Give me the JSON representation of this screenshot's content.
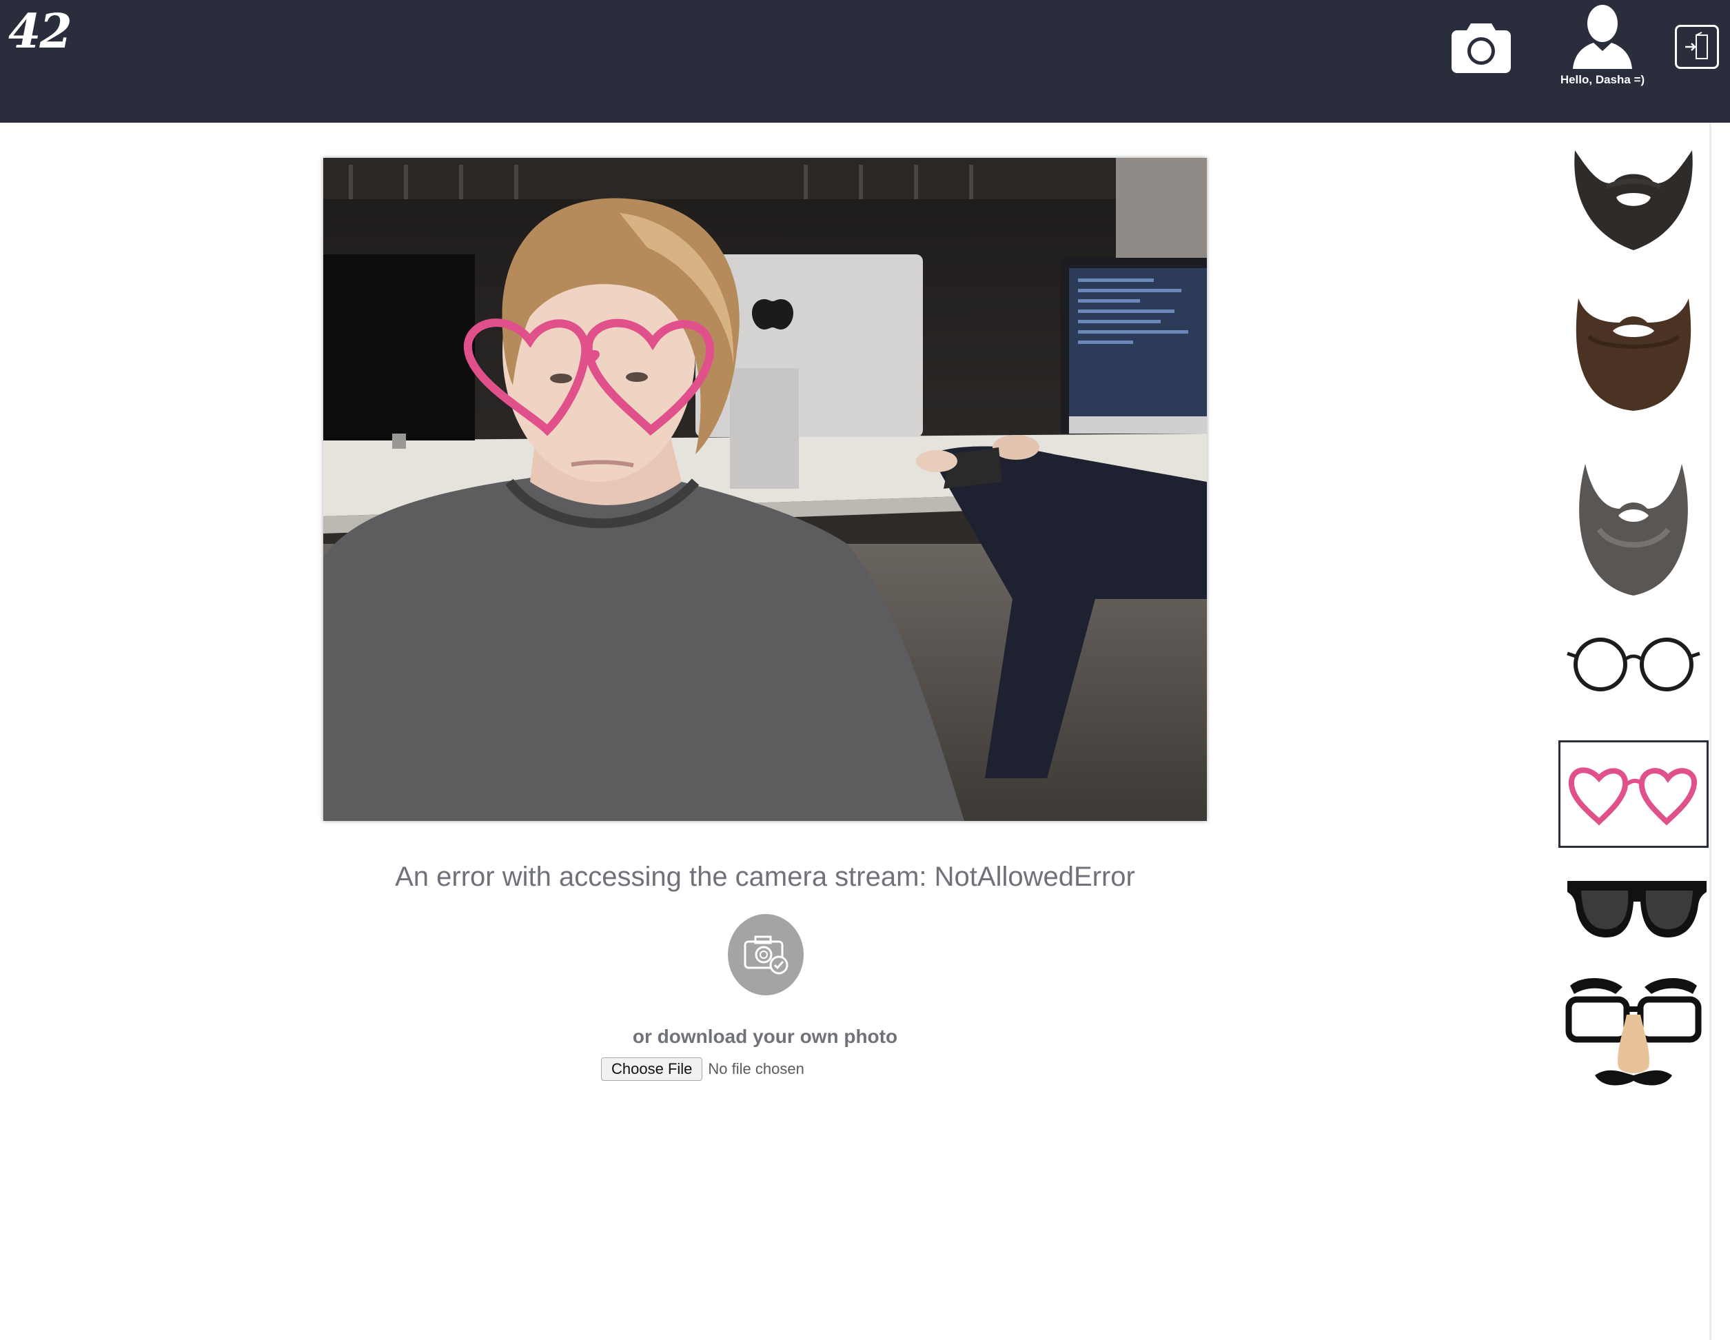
{
  "header": {
    "logo_text": "42",
    "greeting": "Hello, Dasha =)",
    "icons": [
      "camera-icon",
      "user-icon",
      "logout-icon"
    ]
  },
  "preview": {
    "overlay": "heart-glasses"
  },
  "error": {
    "message": "An error with accessing the camera stream: NotAllowedError"
  },
  "upload": {
    "hint": "or download your own photo",
    "choose_label": "Choose File",
    "status": "No file chosen"
  },
  "stickers": {
    "items": [
      "beard-1",
      "beard-2",
      "beard-3",
      "round-glasses",
      "heart-glasses",
      "sunglasses",
      "groucho-glasses"
    ],
    "selected": "heart-glasses"
  },
  "colors": {
    "topbar": "#2a2d3b",
    "text_muted": "#6f7279",
    "heart_pink": "#e0508a"
  }
}
